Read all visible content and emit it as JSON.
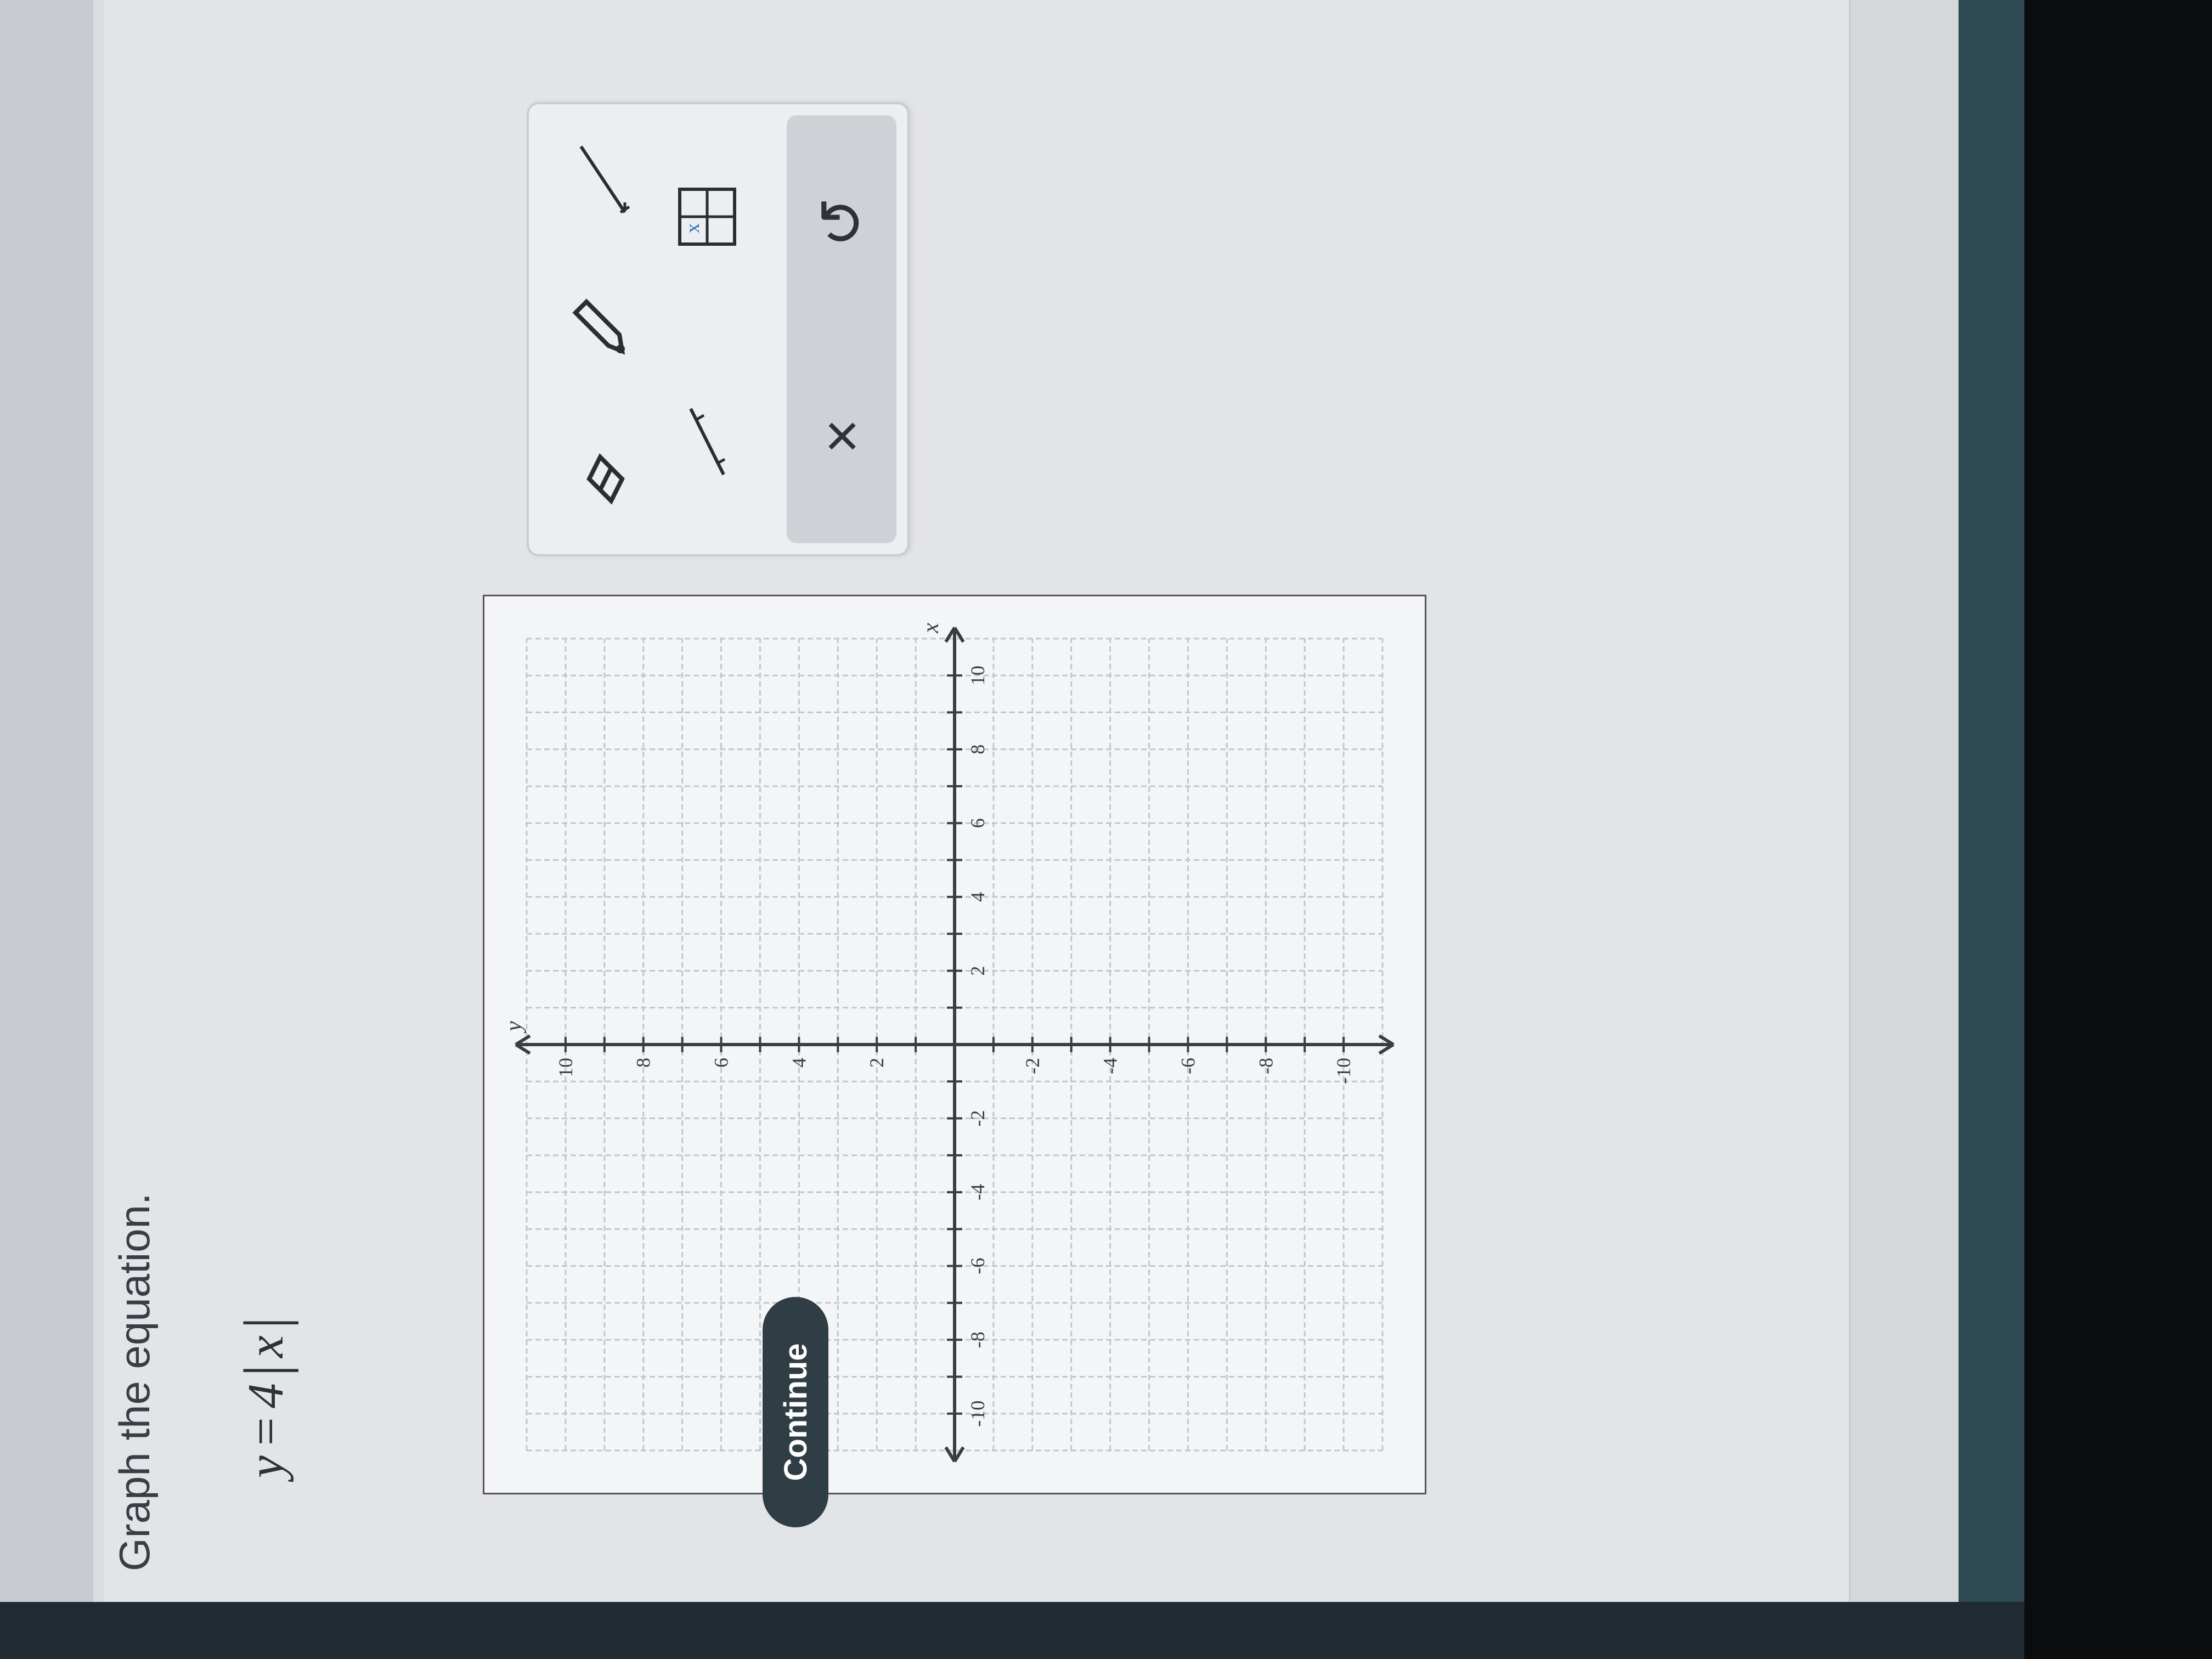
{
  "question": {
    "title": "Graph the equation."
  },
  "equation": {
    "lhs": "y",
    "eq": "=",
    "coef": "4",
    "bar": "|",
    "var": "x"
  },
  "graph": {
    "axis_x_label": "x",
    "axis_y_label": "y",
    "x_tick_labels": [
      "-10",
      "-8",
      "-6",
      "-4",
      "-2",
      "2",
      "4",
      "6",
      "8",
      "10"
    ],
    "y_tick_labels": [
      "10",
      "8",
      "6",
      "4",
      "2",
      "-2",
      "-4",
      "-6",
      "-8",
      "-10"
    ],
    "x_range": [
      -11,
      11
    ],
    "y_range": [
      -11,
      11
    ]
  },
  "toolbox": {
    "tools": [
      "eraser-icon",
      "pencil-icon",
      "ray-icon",
      "line-icon",
      "table-icon"
    ],
    "actions": [
      "×",
      "↺"
    ]
  },
  "footer": {
    "continue_label": "Continue"
  }
}
